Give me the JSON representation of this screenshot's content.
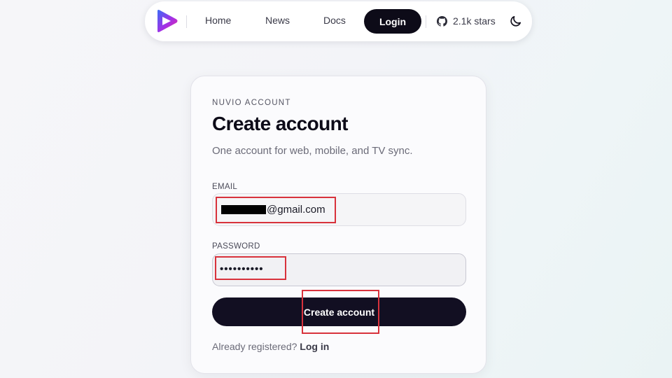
{
  "nav": {
    "logo_icon": "play-triangle-logo-icon",
    "links": [
      "Home",
      "News",
      "Docs"
    ],
    "login_label": "Login",
    "github_icon": "github-icon",
    "stars_label": "2.1k stars",
    "theme_icon": "moon-icon"
  },
  "card": {
    "eyebrow": "NUVIO ACCOUNT",
    "title": "Create account",
    "subtitle": "One account for web, mobile, and TV sync.",
    "email": {
      "label": "EMAIL",
      "value_suffix": "@gmail.com"
    },
    "password": {
      "label": "PASSWORD",
      "value": "••••••••••"
    },
    "submit_label": "Create account",
    "footer": {
      "prompt": "Already registered?",
      "link": "Log in"
    }
  },
  "colors": {
    "primary_dark": "#0d0b18",
    "annotation_red": "#d8323c",
    "logo_gradient": [
      "#3b6cf6",
      "#a330e6",
      "#e52aa0"
    ]
  }
}
